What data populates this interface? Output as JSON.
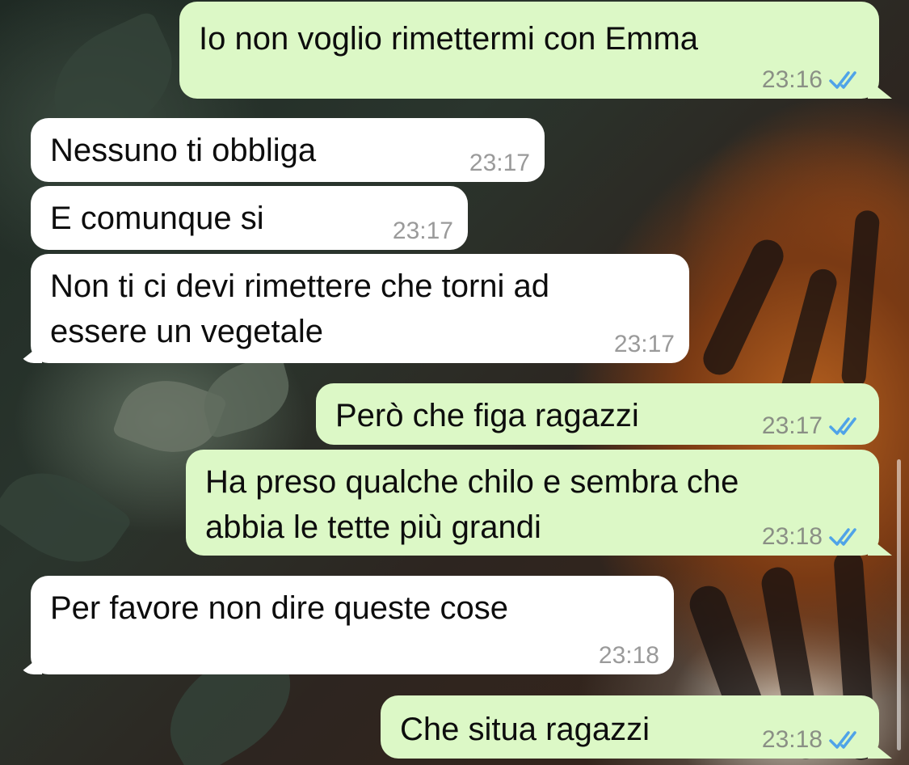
{
  "chat": {
    "messages": [
      {
        "direction": "out",
        "text": "Io non voglio rimettermi con Emma",
        "time": "23:16",
        "status_icon": "double-check-read-icon"
      },
      {
        "direction": "in",
        "text": "Nessuno ti obbliga",
        "time": "23:17"
      },
      {
        "direction": "in",
        "text": "E comunque si",
        "time": "23:17"
      },
      {
        "direction": "in",
        "text": "Non ti ci devi rimettere che torni ad\nessere un vegetale",
        "time": "23:17"
      },
      {
        "direction": "out",
        "text": "Però che figa ragazzi",
        "time": "23:17",
        "status_icon": "double-check-read-icon"
      },
      {
        "direction": "out",
        "text": "Ha preso qualche chilo e sembra che\nabbia le tette più grandi",
        "time": "23:18",
        "status_icon": "double-check-read-icon"
      },
      {
        "direction": "in",
        "text": "Per favore non dire queste cose",
        "time": "23:18"
      },
      {
        "direction": "out",
        "text": "Che situa ragazzi",
        "time": "23:18",
        "status_icon": "double-check-read-icon"
      }
    ]
  },
  "colors": {
    "outgoing_bubble": "#dcf8c6",
    "incoming_bubble": "#ffffff",
    "read_ticks": "#4fa3e8"
  }
}
